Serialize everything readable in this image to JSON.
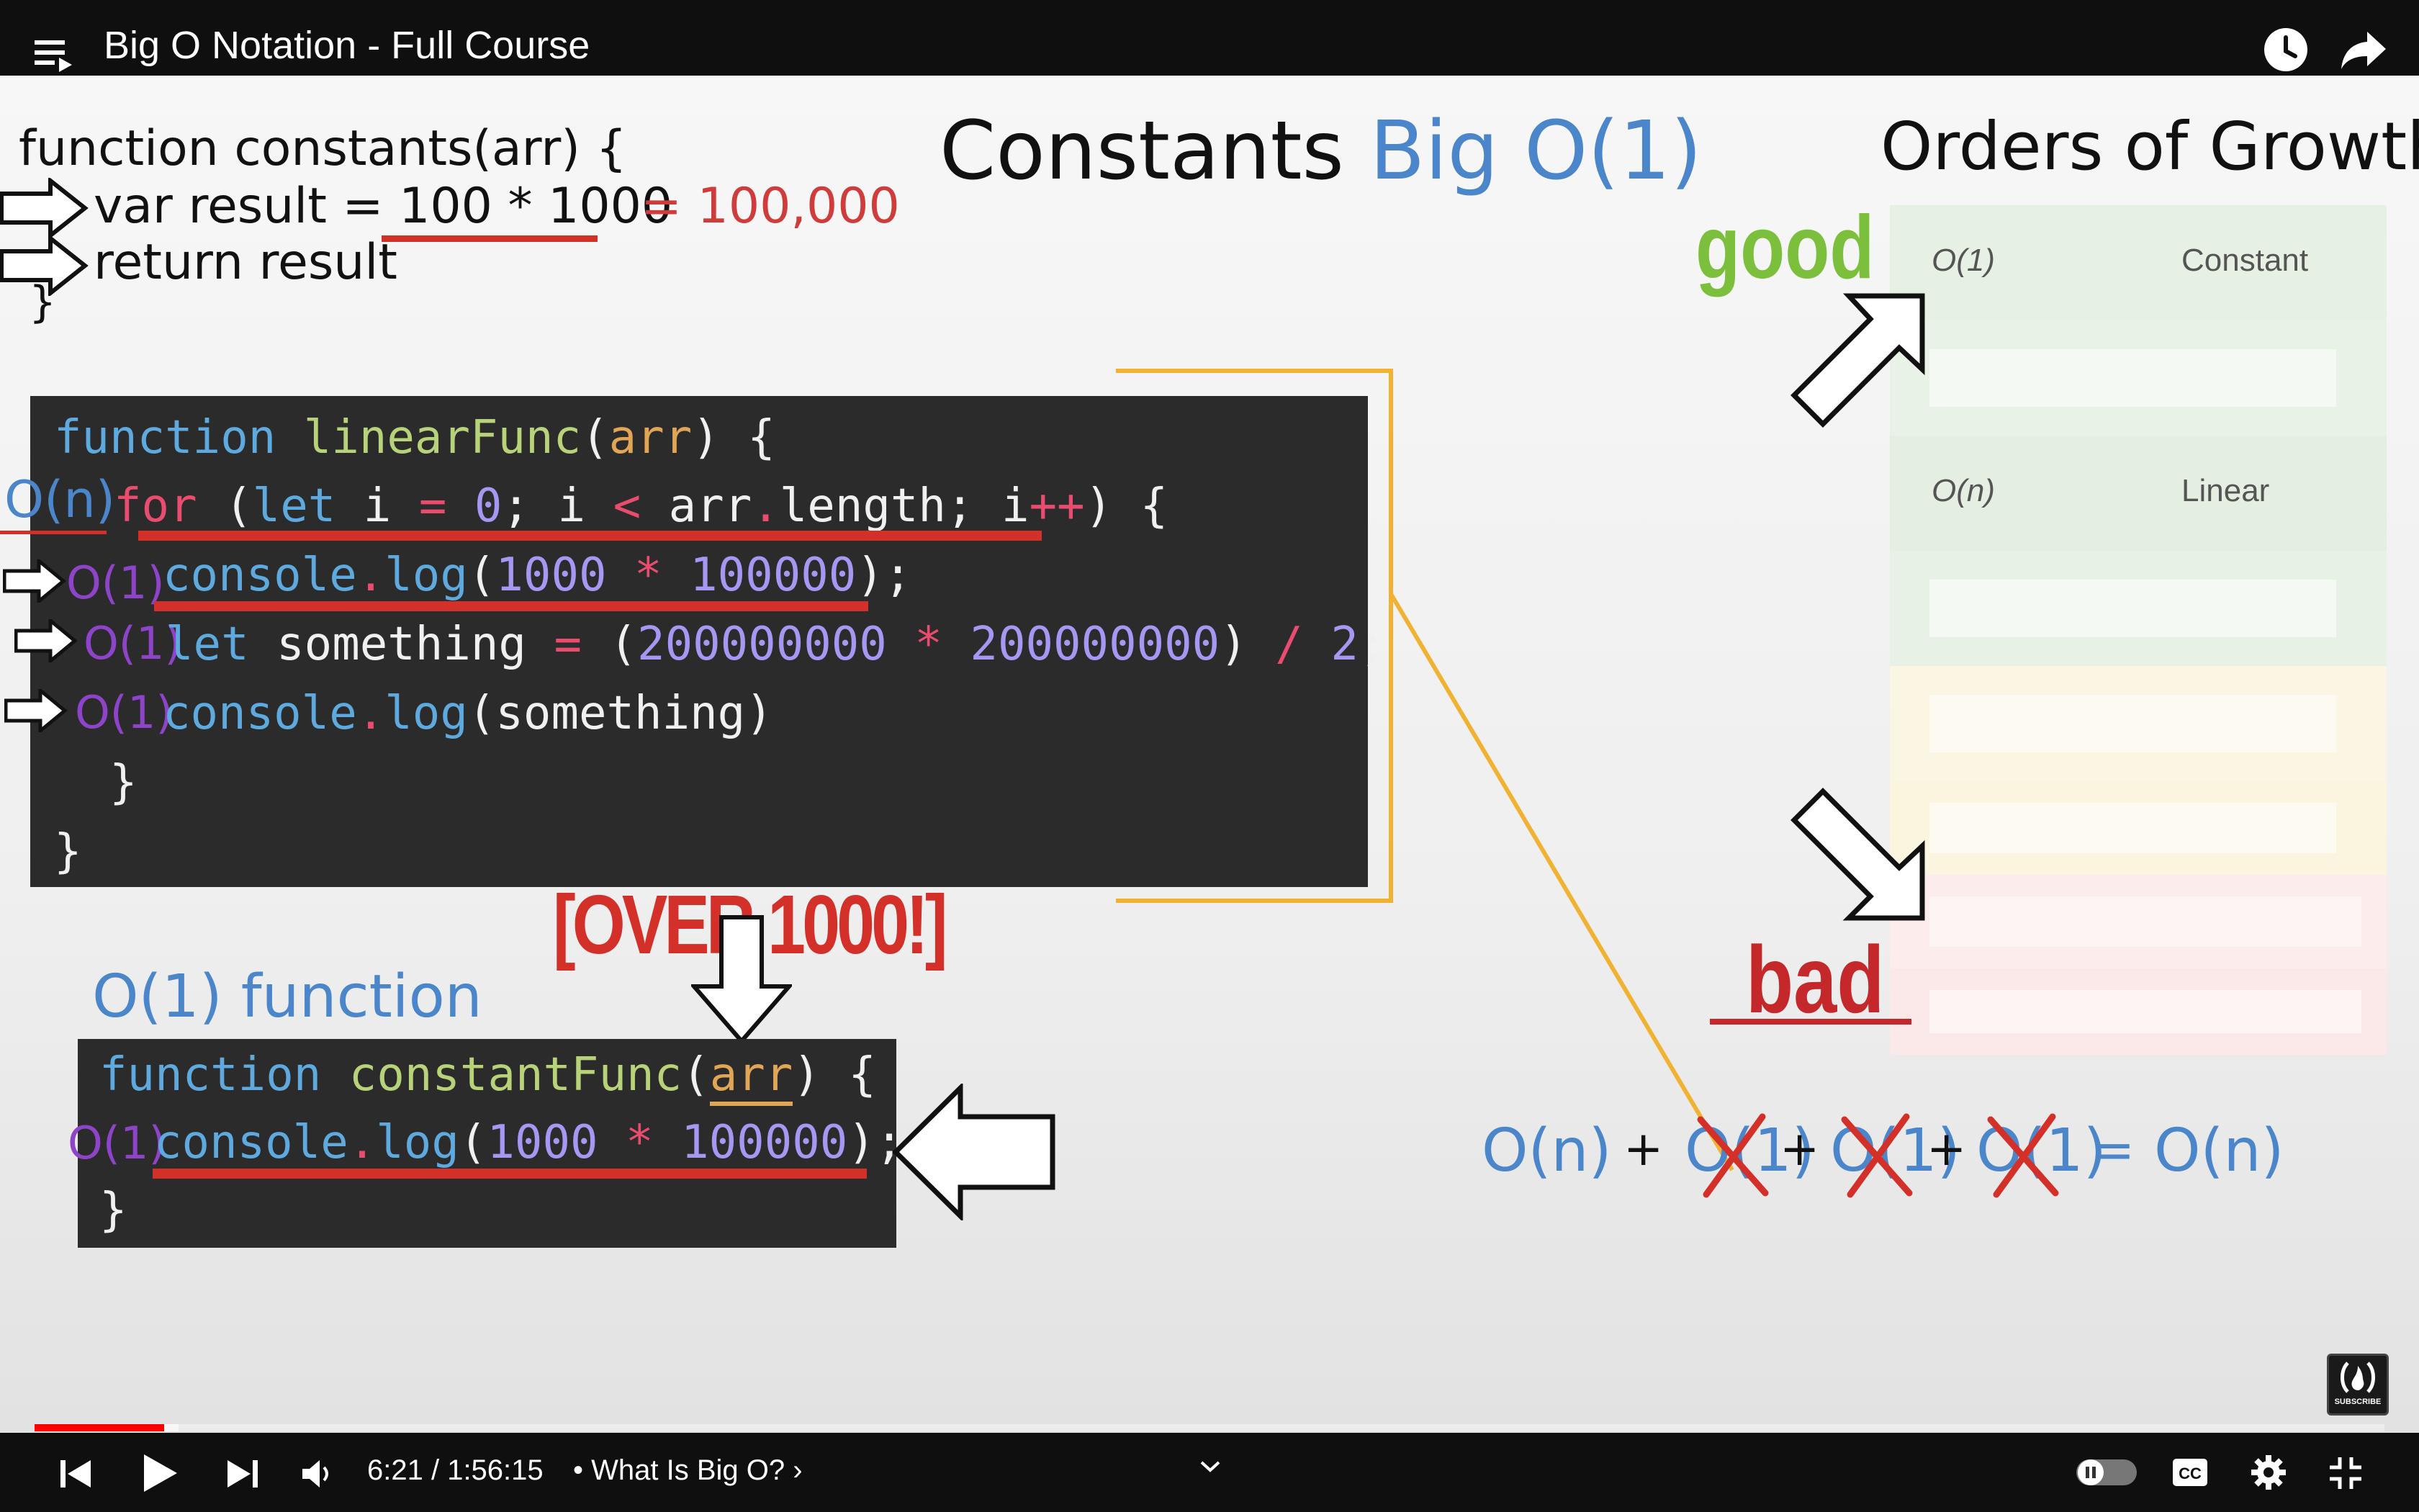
{
  "app": {
    "video_title": "Big O Notation - Full Course"
  },
  "slide": {
    "heading_main": "Constants",
    "heading_accent": "Big O(1)",
    "orders_title": "Orders of Growth",
    "constants_code": {
      "line1": "function constants(arr) {",
      "line2_code": "var result = 100 * 1000",
      "line2_result": "= 100,000",
      "line3": "return result",
      "line4": "}"
    },
    "linear_code": {
      "line1_kw": "function",
      "line1_name": "linearFunc",
      "line1_param": "arr",
      "line2_on": "O(n)",
      "line2_for": "for",
      "line2_let": "let",
      "line2_i": "i",
      "line2_eq": "=",
      "line2_zero": "0",
      "line2_lt": "<",
      "line2_arr": "arr",
      "line2_len": "length",
      "line2_inc": "++",
      "line3_o1": "O(1)",
      "line3_console": "console",
      "line3_log": "log",
      "line3_a": "1000",
      "line3_mul": "*",
      "line3_b": "100000",
      "line4_o1": "O(1)",
      "line4_let": "let",
      "line4_something": "something",
      "line4_eq": "=",
      "line4_a": "200000000",
      "line4_mul": "*",
      "line4_b": "200000000",
      "line4_div": "/",
      "line4_two": "2",
      "line5_o1": "O(1)",
      "line5_console": "console",
      "line5_log": "log",
      "line5_arg": "something"
    },
    "over_label": "[OVER 1000!]",
    "o1_function_label": "O(1) function",
    "constant_code": {
      "line1_kw": "function",
      "line1_name": "constantFunc",
      "line1_param": "arr",
      "line2_o1": "O(1)",
      "line2_console": "console",
      "line2_log": "log",
      "line2_a": "1000",
      "line2_mul": "*",
      "line2_b": "100000"
    },
    "good_label": "good",
    "bad_label": "bad",
    "growth_rows": [
      {
        "notation": "O(1)",
        "name": "Constant"
      },
      {
        "notation": "O(n)",
        "name": "Linear"
      }
    ],
    "equation": {
      "lhs": "O(n)",
      "plus": "+",
      "crossed": "O(1)",
      "equals": "=",
      "rhs": "O(n)"
    },
    "subscribe_label": "SUBSCRIBE"
  },
  "player": {
    "time": "6:21 / 1:56:15",
    "chapter": "• What Is Big O? ›",
    "progress_fraction": 0.055
  }
}
